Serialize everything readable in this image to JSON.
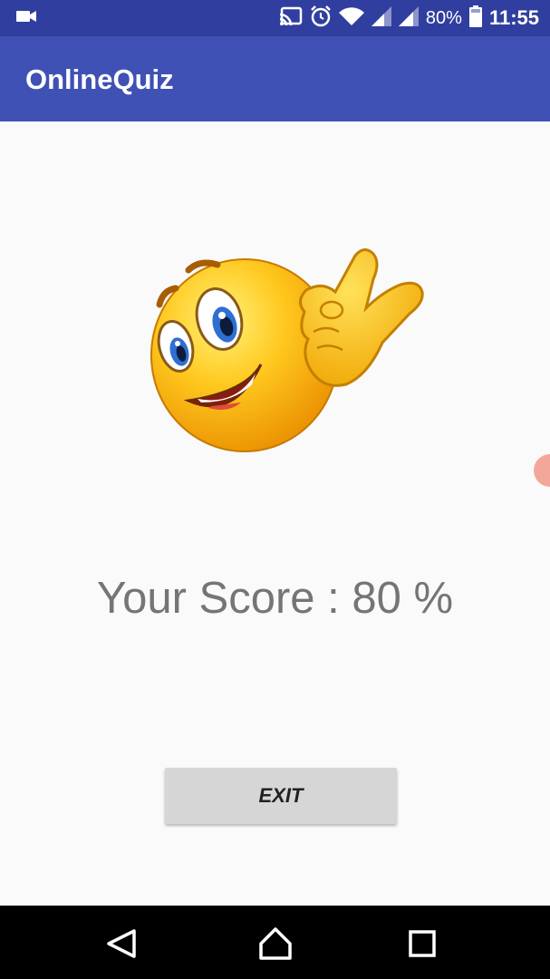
{
  "status_bar": {
    "battery_text": "80%",
    "time": "11:55",
    "icons": [
      "video-camera-icon",
      "cast-icon",
      "alarm-icon",
      "wifi-icon",
      "signal-icon",
      "signal-icon",
      "battery-icon"
    ]
  },
  "app_bar": {
    "title": "OnlineQuiz",
    "color": "#3f51b5",
    "status_color": "#303f9f"
  },
  "result": {
    "image": "winking-ok-emoji-icon",
    "score_text": "Your Score : 80  %"
  },
  "actions": {
    "exit_label": "EXIT"
  },
  "nav_bar": {
    "icons": [
      "back-icon",
      "home-icon",
      "recent-apps-icon"
    ]
  }
}
